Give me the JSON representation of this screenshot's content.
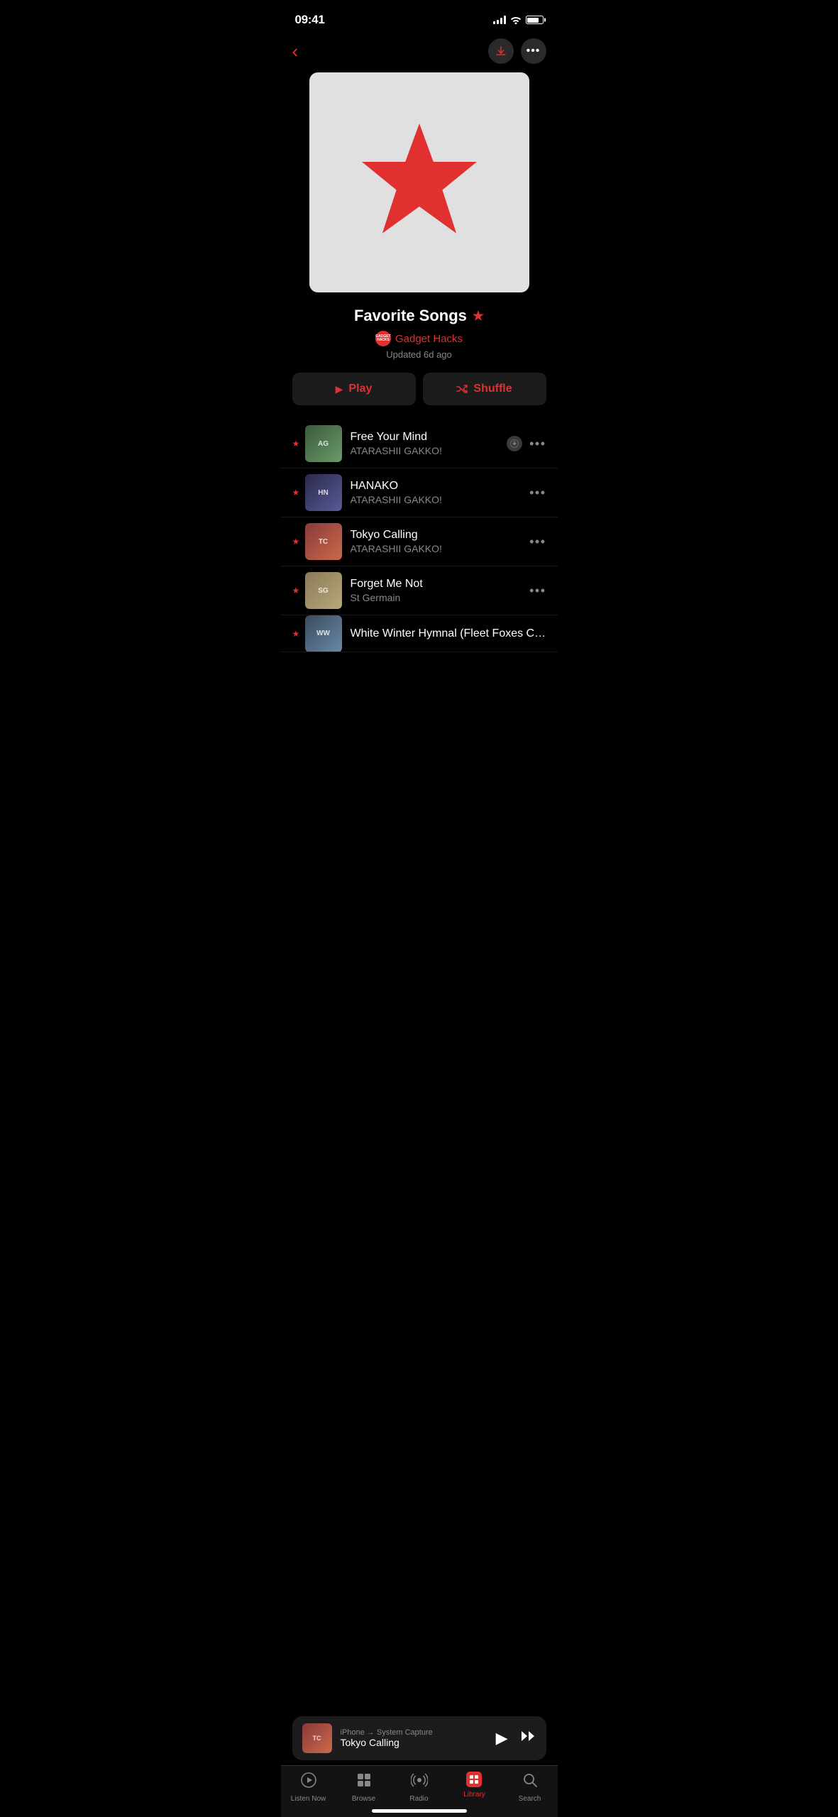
{
  "statusBar": {
    "time": "09:41"
  },
  "nav": {
    "backIcon": "‹",
    "downloadIcon": "↓",
    "moreIcon": "•••"
  },
  "playlist": {
    "title": "Favorite Songs",
    "titleStar": "★",
    "authorBadge": "GADGET\nHACKS",
    "authorName": "Gadget Hacks",
    "updated": "Updated 6d ago",
    "playLabel": "Play",
    "shuffleLabel": "Shuffle"
  },
  "songs": [
    {
      "title": "Free Your Mind",
      "artist": "ATARASHII GAKKO!",
      "hasDownload": true,
      "hasStar": true,
      "thumbClass": "thumb-free-your-mind",
      "thumbText": "AG"
    },
    {
      "title": "HANAKO",
      "artist": "ATARASHII GAKKO!",
      "hasDownload": false,
      "hasStar": true,
      "thumbClass": "thumb-hanako",
      "thumbText": "HN"
    },
    {
      "title": "Tokyo Calling",
      "artist": "ATARASHII GAKKO!",
      "hasDownload": false,
      "hasStar": true,
      "thumbClass": "thumb-tokyo-calling",
      "thumbText": "TC"
    },
    {
      "title": "Forget Me Not",
      "artist": "St Germain",
      "hasDownload": false,
      "hasStar": true,
      "thumbClass": "thumb-forget-me-not",
      "thumbText": "SG"
    },
    {
      "title": "White Winter Hymnal (Fleet Foxes Cover)",
      "artist": "",
      "hasDownload": false,
      "hasStar": true,
      "thumbClass": "thumb-white-winter",
      "thumbText": "WW",
      "partial": true
    }
  ],
  "miniPlayer": {
    "source": "iPhone → System Capture",
    "title": "Tokyo Calling",
    "thumbClass": "thumb-tokyo-calling",
    "thumbText": "TC"
  },
  "tabBar": {
    "items": [
      {
        "label": "Listen Now",
        "icon": "▶",
        "iconType": "circle-play",
        "active": false
      },
      {
        "label": "Browse",
        "icon": "⊞",
        "iconType": "grid",
        "active": false
      },
      {
        "label": "Radio",
        "icon": "radio",
        "iconType": "radio",
        "active": false
      },
      {
        "label": "Library",
        "icon": "library",
        "iconType": "library",
        "active": true
      },
      {
        "label": "Search",
        "icon": "🔍",
        "iconType": "search",
        "active": false
      }
    ]
  }
}
